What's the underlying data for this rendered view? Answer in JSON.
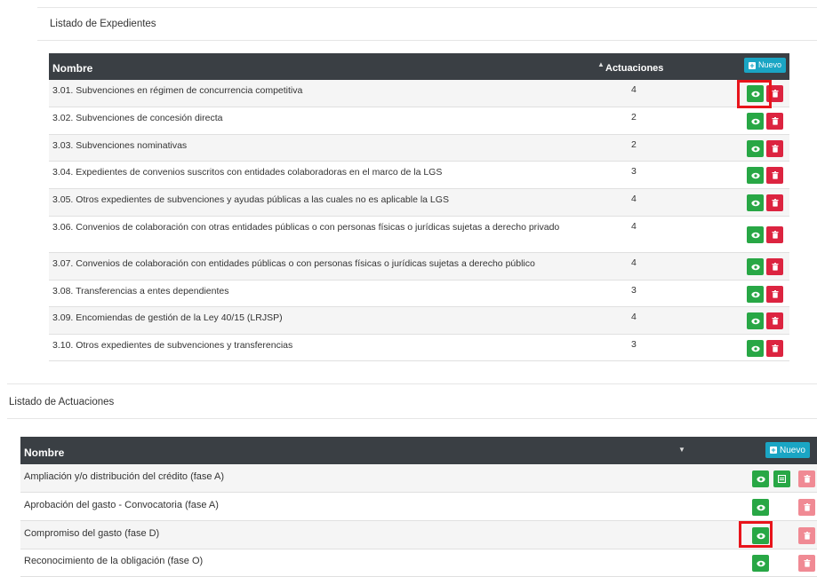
{
  "expedientes": {
    "title": "Listado de Expedientes",
    "col_name": "Nombre",
    "col_count": "Actuaciones",
    "new_label": "Nuevo",
    "rows": [
      {
        "name": "3.01. Subvenciones en régimen de concurrencia competitiva",
        "count": "4"
      },
      {
        "name": "3.02. Subvenciones de concesión directa",
        "count": "2"
      },
      {
        "name": "3.03. Subvenciones nominativas",
        "count": "2"
      },
      {
        "name": "3.04. Expedientes de convenios suscritos con entidades colaboradoras en el marco de la LGS",
        "count": "3"
      },
      {
        "name": "3.05. Otros expedientes de subvenciones y ayudas públicas a las cuales no es aplicable la LGS",
        "count": "4"
      },
      {
        "name": "3.06. Convenios de colaboración con otras entidades públicas o con personas físicas o jurídicas sujetas a derecho privado",
        "count": "4"
      },
      {
        "name": "3.07. Convenios de colaboración con entidades públicas o con personas físicas o jurídicas sujetas a derecho público",
        "count": "4"
      },
      {
        "name": "3.08. Transferencias a entes dependientes",
        "count": "3"
      },
      {
        "name": "3.09. Encomiendas de gestión de la Ley 40/15 (LRJSP)",
        "count": "4"
      },
      {
        "name": "3.10. Otros expedientes de subvenciones y transferencias",
        "count": "3"
      }
    ]
  },
  "actuaciones": {
    "title": "Listado de Actuaciones",
    "col_name": "Nombre",
    "new_label": "Nuevo",
    "rows": [
      {
        "name": "Ampliación y/o distribución del crédito (fase A)"
      },
      {
        "name": "Aprobación del gasto - Convocatoria (fase A)"
      },
      {
        "name": "Compromiso del gasto (fase D)"
      },
      {
        "name": "Reconocimiento de la obligación (fase O)"
      }
    ]
  },
  "icons": {
    "view": "eye-icon",
    "delete": "trash-icon",
    "document": "document-icon",
    "add": "plus-square-icon",
    "sort": "sort-caret-icon"
  },
  "colors": {
    "header_bg": "#3a3f44",
    "new_button": "#1aa5c4",
    "view_button": "#28a745",
    "delete_button": "#dc2440",
    "delete_disabled": "#f08a94",
    "highlight": "#e8141b"
  }
}
